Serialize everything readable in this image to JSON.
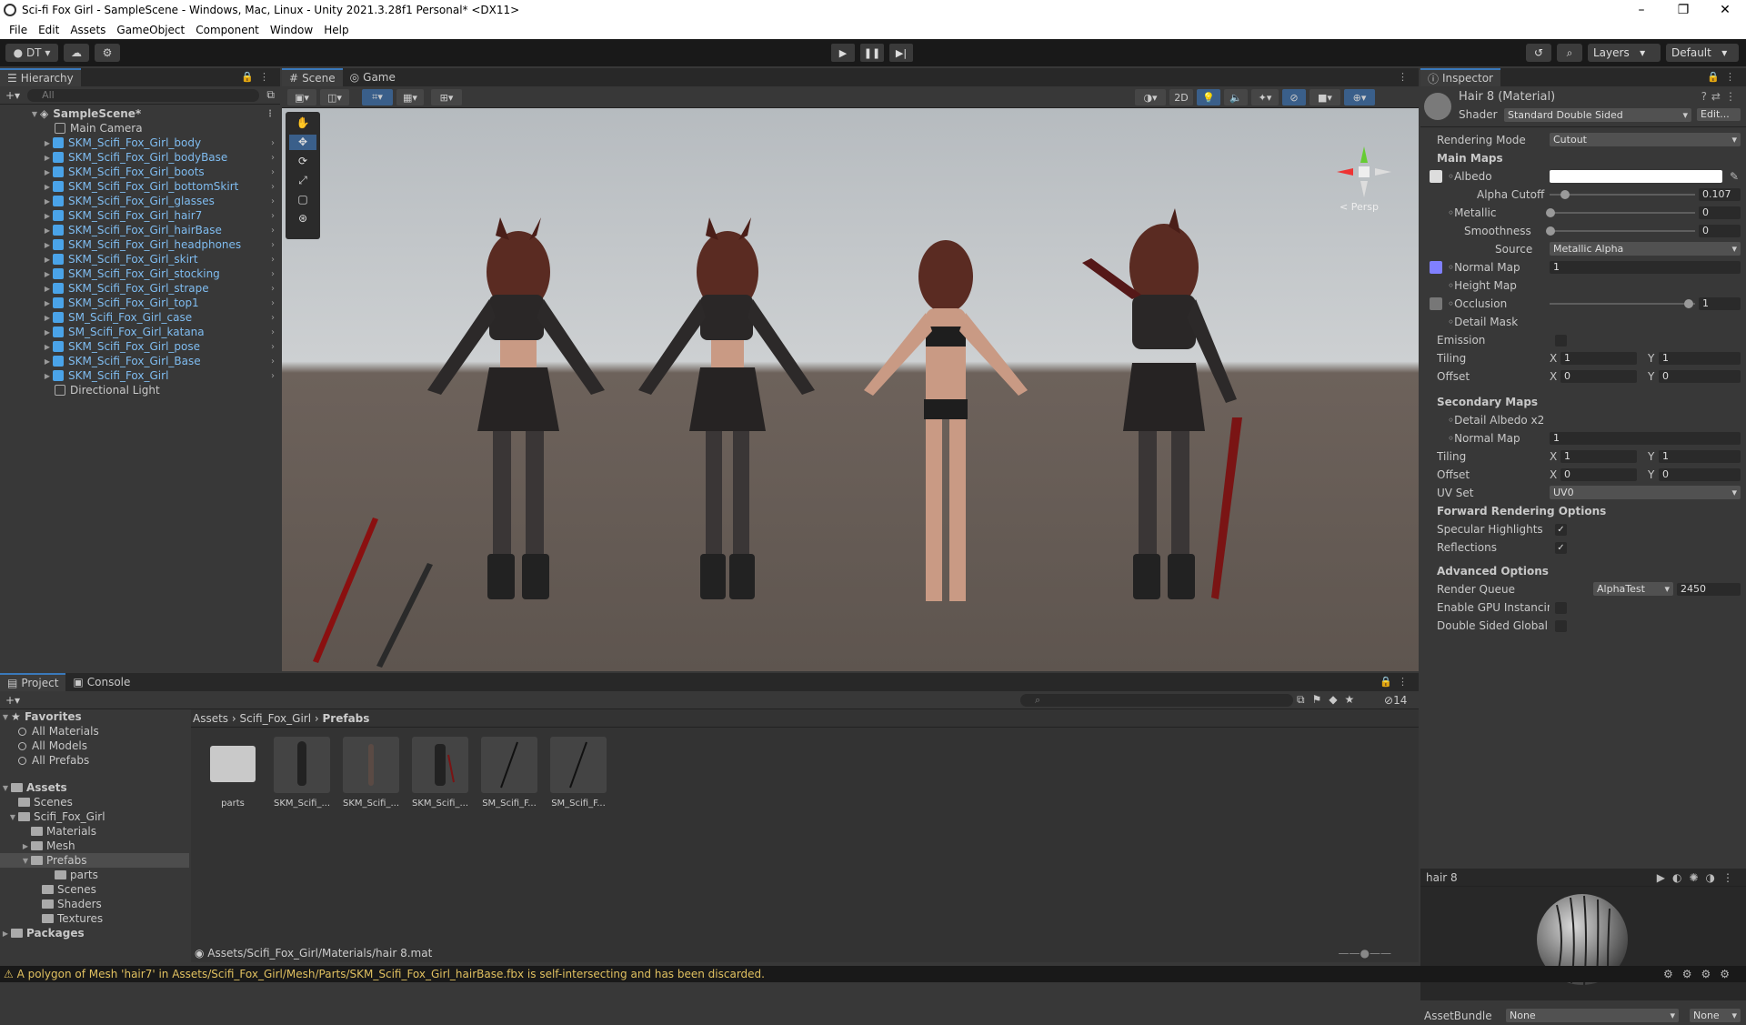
{
  "window": {
    "title": "Sci-fi Fox Girl - SampleScene - Windows, Mac, Linux - Unity 2021.3.28f1 Personal* <DX11>"
  },
  "menu": [
    "File",
    "Edit",
    "Assets",
    "GameObject",
    "Component",
    "Window",
    "Help"
  ],
  "toolbar": {
    "account": "DT",
    "layers": "Layers",
    "layout": "Default"
  },
  "hierarchy": {
    "tab": "Hierarchy",
    "search_placeholder": "All",
    "scene": "SampleScene*",
    "items": [
      "Main Camera",
      "SKM_Scifi_Fox_Girl_body",
      "SKM_Scifi_Fox_Girl_bodyBase",
      "SKM_Scifi_Fox_Girl_boots",
      "SKM_Scifi_Fox_Girl_bottomSkirt",
      "SKM_Scifi_Fox_Girl_glasses",
      "SKM_Scifi_Fox_Girl_hair7",
      "SKM_Scifi_Fox_Girl_hairBase",
      "SKM_Scifi_Fox_Girl_headphones",
      "SKM_Scifi_Fox_Girl_skirt",
      "SKM_Scifi_Fox_Girl_stocking",
      "SKM_Scifi_Fox_Girl_strape",
      "SKM_Scifi_Fox_Girl_top1",
      "SM_Scifi_Fox_Girl_case",
      "SM_Scifi_Fox_Girl_katana",
      "SKM_Scifi_Fox_Girl_pose",
      "SKM_Scifi_Fox_Girl_Base",
      "SKM_Scifi_Fox_Girl",
      "Directional Light"
    ]
  },
  "scene": {
    "tab_scene": "Scene",
    "tab_game": "Game",
    "mode_2d": "2D",
    "persp": "< Persp"
  },
  "project": {
    "tab_project": "Project",
    "tab_console": "Console",
    "favorites": "Favorites",
    "fav_items": [
      "All Materials",
      "All Models",
      "All Prefabs"
    ],
    "assets": "Assets",
    "asset_tree": {
      "scenes": "Scenes",
      "scifi": "Scifi_Fox_Girl",
      "materials": "Materials",
      "mesh": "Mesh",
      "prefabs": "Prefabs",
      "parts": "parts",
      "scenes2": "Scenes",
      "shaders": "Shaders",
      "textures": "Textures"
    },
    "packages": "Packages",
    "breadcrumb": [
      "Assets",
      "Scifi_Fox_Girl",
      "Prefabs"
    ],
    "hidden_count": "14",
    "grid": [
      "parts",
      "SKM_Scifi_...",
      "SKM_Scifi_...",
      "SKM_Scifi_...",
      "SM_Scifi_F...",
      "SM_Scifi_F..."
    ],
    "path": "Assets/Scifi_Fox_Girl/Materials/hair 8.mat"
  },
  "inspector": {
    "tab": "Inspector",
    "title": "Hair 8 (Material)",
    "shader_label": "Shader",
    "shader": "Standard Double Sided",
    "edit": "Edit...",
    "rendering_mode_label": "Rendering Mode",
    "rendering_mode": "Cutout",
    "main_maps": "Main Maps",
    "albedo": "Albedo",
    "alpha_cutoff_label": "Alpha Cutoff",
    "alpha_cutoff": "0.107",
    "metallic_label": "Metallic",
    "metallic": "0",
    "smoothness_label": "Smoothness",
    "smoothness": "0",
    "source_label": "Source",
    "source": "Metallic Alpha",
    "normal_map_label": "Normal Map",
    "normal_map": "1",
    "height_map": "Height Map",
    "occlusion_label": "Occlusion",
    "occlusion": "1",
    "detail_mask": "Detail Mask",
    "emission": "Emission",
    "tiling_label": "Tiling",
    "offset_label": "Offset",
    "x": "X",
    "y": "Y",
    "tiling_x": "1",
    "tiling_y": "1",
    "offset_x": "0",
    "offset_y": "0",
    "secondary_maps": "Secondary Maps",
    "detail_albedo": "Detail Albedo x2",
    "normal_map2_label": "Normal Map",
    "normal_map2": "1",
    "tiling2_x": "1",
    "tiling2_y": "1",
    "offset2_x": "0",
    "offset2_y": "0",
    "uv_set_label": "UV Set",
    "uv_set": "UV0",
    "forward": "Forward Rendering Options",
    "specular": "Specular Highlights",
    "reflections": "Reflections",
    "advanced": "Advanced Options",
    "render_queue_label": "Render Queue",
    "render_queue_mode": "AlphaTest",
    "render_queue": "2450",
    "gpu_instancing": "Enable GPU Instancin",
    "double_sided_gi": "Double Sided Global I",
    "preview_name": "hair 8",
    "assetbundle_label": "AssetBundle",
    "assetbundle": "None",
    "assetbundle_variant": "None"
  },
  "status": {
    "message": "A polygon of Mesh 'hair7' in Assets/Scifi_Fox_Girl/Mesh/Parts/SKM_Scifi_Fox_Girl_hairBase.fbx is self-intersecting and has been discarded."
  },
  "colors": {
    "accent": "#3a79bb",
    "selection": "#2c5d87",
    "warning": "#e0c060",
    "cube": "#4aa3e8"
  }
}
